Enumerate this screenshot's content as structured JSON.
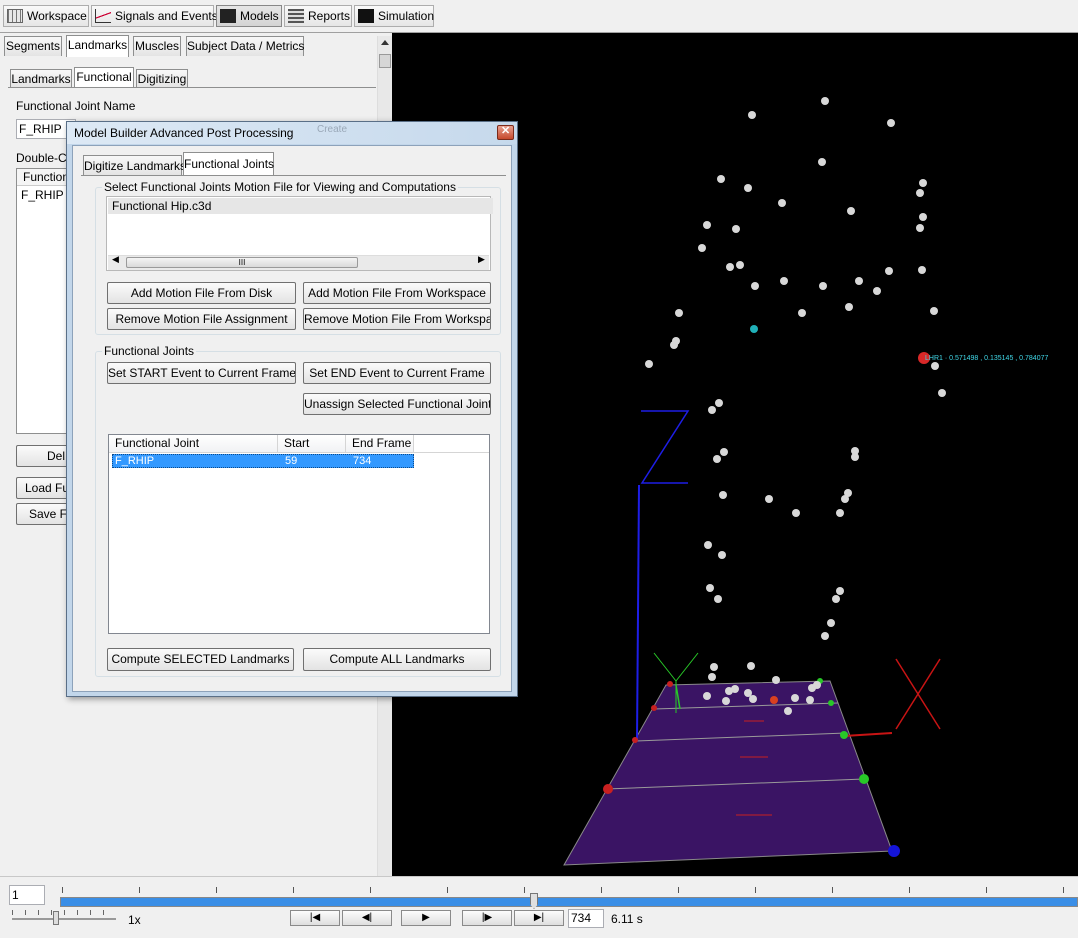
{
  "toolbar": {
    "tabs": [
      {
        "label": "Workspace",
        "icon": "grid-icon"
      },
      {
        "label": "Signals and Events",
        "icon": "signal-icon"
      },
      {
        "label": "Models",
        "icon": "model-icon"
      },
      {
        "label": "Reports",
        "icon": "report-icon"
      },
      {
        "label": "Simulation",
        "icon": "simulation-icon"
      }
    ],
    "active": "Models"
  },
  "left_panel": {
    "tabs": [
      "Segments",
      "Landmarks",
      "Muscles",
      "Subject Data / Metrics"
    ],
    "active_tab": "Landmarks",
    "subtabs": [
      "Landmarks",
      "Functional",
      "Digitizing"
    ],
    "active_subtab": "Functional",
    "joint_name_label": "Functional Joint Name",
    "joint_name_value": "F_RHIP",
    "list_label": "Double-Cli",
    "list_header": "Functiona",
    "list_items": [
      "F_RHIP"
    ],
    "delete_btn": "Del",
    "load_btn": "Load Fun",
    "save_btn": "Save Fu"
  },
  "dialog": {
    "title": "Model Builder Advanced Post Processing",
    "behind_title": "Create",
    "tabs": [
      "Digitize Landmarks",
      "Functional Joints"
    ],
    "active_tab": "Functional Joints",
    "motion_group_label": "Select Functional Joints Motion File for Viewing and Computations",
    "motion_files": [
      "Functional Hip.c3d"
    ],
    "scroll_grip": "III",
    "buttons": {
      "add_disk": "Add Motion File From Disk",
      "add_workspace": "Add Motion File From Workspace",
      "remove_assignment": "Remove Motion File Assignment",
      "remove_workspace": "Remove Motion File From Workspace",
      "set_start": "Set START Event to Current Frame",
      "set_end": "Set END Event to Current Frame",
      "unassign": "Unassign Selected Functional Joints",
      "compute_selected": "Compute SELECTED Landmarks",
      "compute_all": "Compute ALL Landmarks"
    },
    "fj_group_label": "Functional Joints",
    "table": {
      "columns": [
        "Functional Joint",
        "Start Frame",
        "End Frame"
      ],
      "rows": [
        [
          "F_RHIP",
          "59",
          "734"
        ]
      ]
    }
  },
  "viewport": {
    "label_text": "LHR1 · 0.571498 , 0.135145 , 0.784077",
    "axis_labels": [
      "Z",
      "Y",
      "X"
    ],
    "colors": {
      "background": "#000000",
      "floor": "#3a1464",
      "x_axis": "#c81414",
      "y_axis": "#28c828",
      "z_axis": "#1e1ee6",
      "label": "#40d8e8"
    }
  },
  "playback": {
    "frame_start_value": "1",
    "current_frame": "734",
    "time": "6.11 s",
    "speed": "1x",
    "position_fraction": 0.5,
    "buttons": [
      "go-start-icon",
      "step-back-icon",
      "play-icon",
      "step-forward-icon",
      "go-end-icon"
    ]
  }
}
